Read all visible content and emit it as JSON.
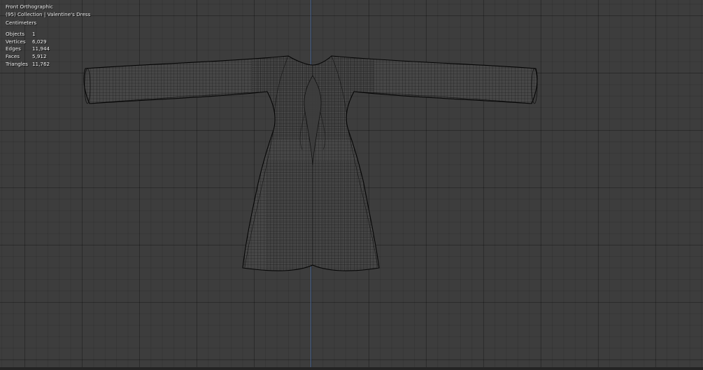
{
  "viewport": {
    "view_name": "Front Orthographic",
    "collection_line": "(95) Collection | Valentine's Dress",
    "units": "Centimeters",
    "stats": [
      {
        "label": "Objects",
        "value": "1"
      },
      {
        "label": "Vertices",
        "value": "6,029"
      },
      {
        "label": "Edges",
        "value": "11,944"
      },
      {
        "label": "Faces",
        "value": "5,912"
      },
      {
        "label": "Triangles",
        "value": "11,762"
      }
    ]
  },
  "colors": {
    "background": "#3d3d3d",
    "grid_line": "#333333",
    "axis_line": "#4b6a9c",
    "wireframe": "#000000",
    "text": "#ececec"
  },
  "mesh": {
    "object_name": "Valentine's Dress",
    "display": "wireframe"
  }
}
